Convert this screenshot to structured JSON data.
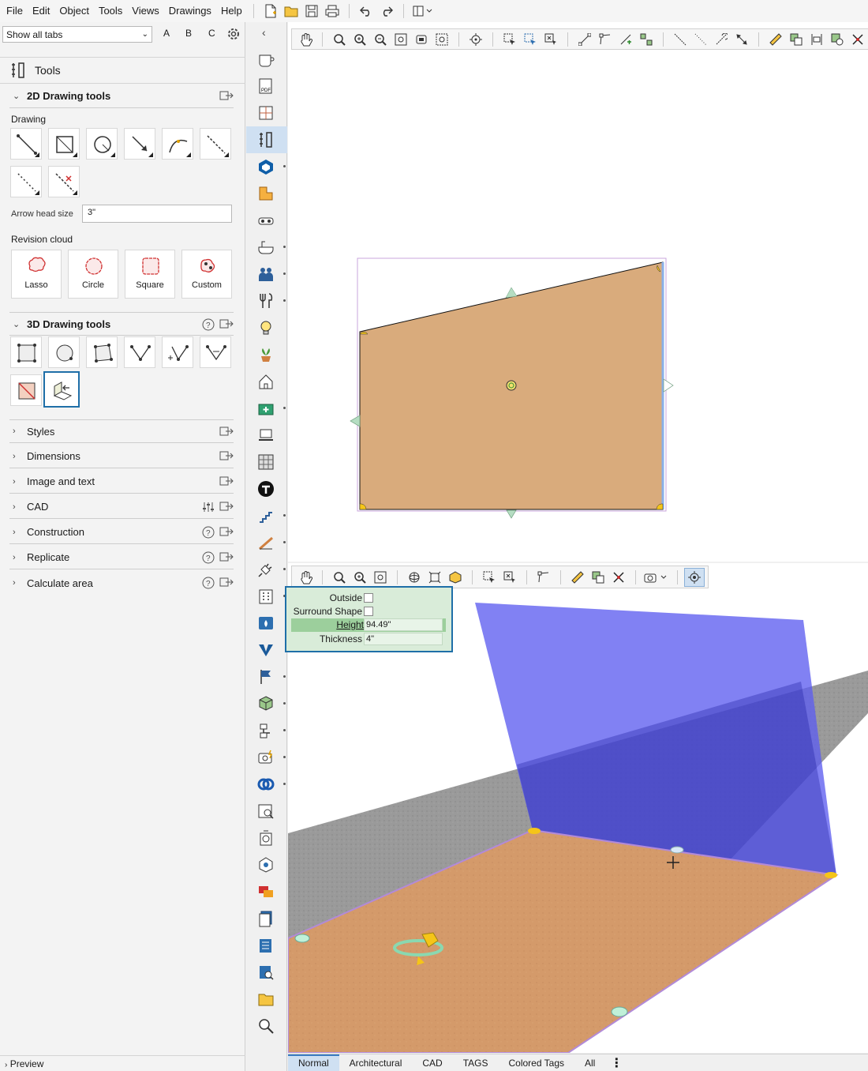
{
  "menubar": {
    "items": [
      "File",
      "Edit",
      "Object",
      "Tools",
      "Views",
      "Drawings",
      "Help"
    ]
  },
  "left_panel": {
    "tab_filter": "Show all tabs",
    "tab_letters": [
      "A",
      "B",
      "C"
    ],
    "title": "Tools",
    "drawing_2d": {
      "title": "2D Drawing tools",
      "drawing_label": "Drawing",
      "arrow_head_label": "Arrow head size",
      "arrow_head_value": "3\"",
      "revision_cloud_label": "Revision cloud",
      "clouds": [
        "Lasso",
        "Circle",
        "Square",
        "Custom"
      ]
    },
    "drawing_3d": {
      "title": "3D Drawing tools"
    },
    "sections": [
      "Styles",
      "Dimensions",
      "Image and text",
      "CAD",
      "Construction",
      "Replicate",
      "Calculate area"
    ],
    "preview_label": "Preview"
  },
  "properties": {
    "outside_label": "Outside",
    "surround_label": "Surround Shape",
    "height_label": "Height",
    "height_value": "94.49\"",
    "thickness_label": "Thickness",
    "thickness_value": "4\""
  },
  "bottom_tabs": [
    "Normal",
    "Architectural",
    "CAD",
    "TAGS",
    "Colored Tags",
    "All"
  ],
  "colors": {
    "accent": "#1f6fa8",
    "floor": "#d9ab7c",
    "wall": "#6a6af0",
    "ground": "#8f8f8f",
    "property_panel": "#d9ecd9"
  }
}
